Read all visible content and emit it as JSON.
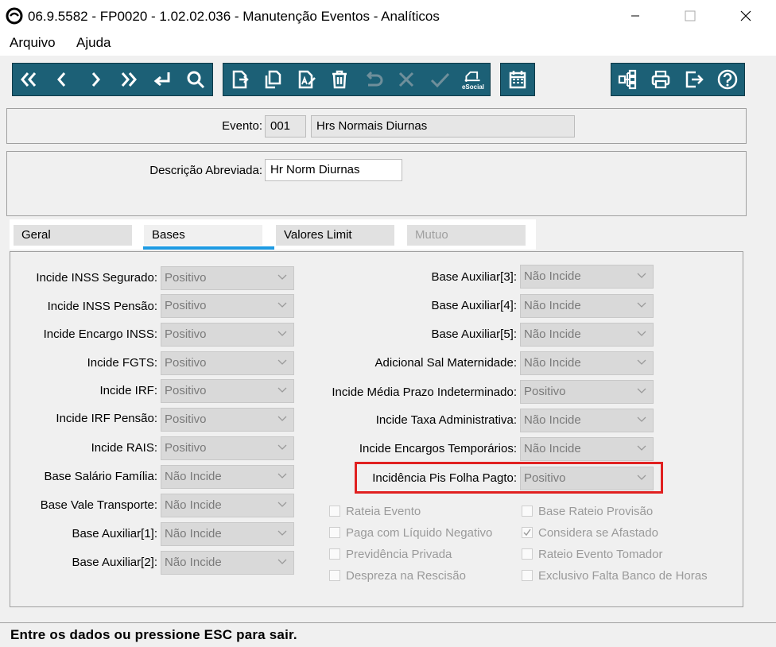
{
  "window": {
    "title": "06.9.5582 - FP0020 - 1.02.02.036 - Manutenção Eventos - Analíticos",
    "minimize_icon": "minimize-icon",
    "maximize_icon": "maximize-icon",
    "close_icon": "close-icon"
  },
  "menu": {
    "file": "Arquivo",
    "help": "Ajuda"
  },
  "toolbar": {
    "color": "#1c6076",
    "esocial_label": "eSocial"
  },
  "header": {
    "evento_label": "Evento:",
    "evento_code": "001",
    "evento_name": "Hrs Normais Diurnas",
    "descricao_label": "Descrição Abreviada:",
    "descricao_value": "Hr Norm Diurnas"
  },
  "tabs": [
    {
      "label": "Geral",
      "state": "normal"
    },
    {
      "label": "Bases",
      "state": "active"
    },
    {
      "label": "Valores Limit",
      "state": "normal"
    },
    {
      "label": "Mutuo",
      "state": "disabled"
    }
  ],
  "left_fields": [
    {
      "label": "Incide INSS Segurado:",
      "value": "Positivo"
    },
    {
      "label": "Incide INSS Pensão:",
      "value": "Positivo"
    },
    {
      "label": "Incide Encargo INSS:",
      "value": "Positivo"
    },
    {
      "label": "Incide FGTS:",
      "value": "Positivo"
    },
    {
      "label": "Incide IRF:",
      "value": "Positivo"
    },
    {
      "label": "Incide IRF Pensão:",
      "value": "Positivo"
    },
    {
      "label": "Incide RAIS:",
      "value": "Positivo"
    },
    {
      "label": "Base Salário Família:",
      "value": "Não Incide"
    },
    {
      "label": "Base Vale Transporte:",
      "value": "Não Incide"
    },
    {
      "label": "Base Auxiliar[1]:",
      "value": "Não Incide"
    },
    {
      "label": "Base Auxiliar[2]:",
      "value": "Não Incide"
    }
  ],
  "right_fields": [
    {
      "label": "Base Auxiliar[3]:",
      "value": "Não Incide"
    },
    {
      "label": "Base Auxiliar[4]:",
      "value": "Não Incide"
    },
    {
      "label": "Base Auxiliar[5]:",
      "value": "Não Incide"
    },
    {
      "label": "Adicional Sal Maternidade:",
      "value": "Não Incide"
    },
    {
      "label": "Incide Média Prazo Indeterminado:",
      "value": "Positivo"
    },
    {
      "label": "Incide Taxa Administrativa:",
      "value": "Não Incide"
    },
    {
      "label": "Incide Encargos Temporários:",
      "value": "Não Incide"
    },
    {
      "label": "Incidência Pis Folha Pagto:",
      "value": "Positivo"
    }
  ],
  "checkboxes_left": [
    {
      "label": "Rateia Evento",
      "checked": false
    },
    {
      "label": "Paga com Líquido Negativo",
      "checked": false
    },
    {
      "label": "Previdência Privada",
      "checked": false
    },
    {
      "label": "Despreza na Rescisão",
      "checked": false
    }
  ],
  "checkboxes_right": [
    {
      "label": "Base Rateio Provisão",
      "checked": false
    },
    {
      "label": "Considera se Afastado",
      "checked": true
    },
    {
      "label": "Rateio Evento Tomador",
      "checked": false
    },
    {
      "label": "Exclusivo Falta Banco de Horas",
      "checked": false
    }
  ],
  "highlight_color": "#e02020",
  "status": "Entre os dados ou pressione ESC para sair."
}
